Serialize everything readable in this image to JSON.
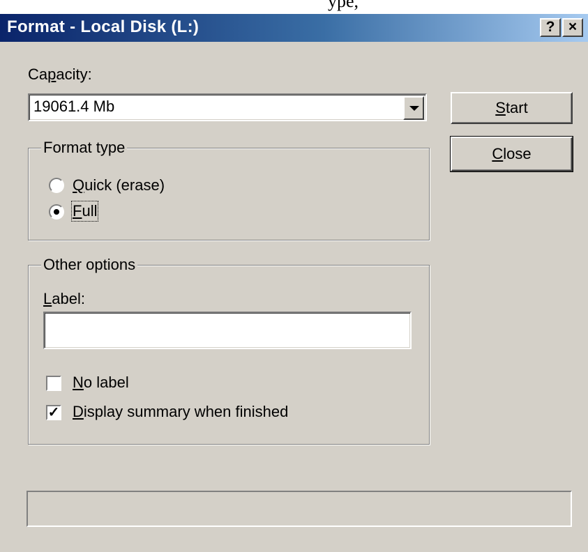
{
  "page": {
    "top_text": "ype, "
  },
  "window": {
    "title": "Format - Local Disk (L:)",
    "help_label": "?",
    "close_label": "×"
  },
  "capacity": {
    "label_pre": "Ca",
    "label_u": "p",
    "label_post": "acity:",
    "value": "19061.4 Mb"
  },
  "buttons": {
    "start": {
      "u": "S",
      "rest": "tart"
    },
    "close": {
      "u": "C",
      "rest": "lose"
    }
  },
  "format_type": {
    "legend": "Format type",
    "quick": {
      "u": "Q",
      "rest": "uick (erase)",
      "selected": false
    },
    "full": {
      "u": "F",
      "rest": "ull",
      "selected": true
    }
  },
  "other_options": {
    "legend": "Other options",
    "label_field": {
      "u": "L",
      "rest": "abel:",
      "value": ""
    },
    "no_label": {
      "u": "N",
      "rest": "o label",
      "checked": false,
      "mark": ""
    },
    "display_summary": {
      "u": "D",
      "rest": "isplay summary when finished",
      "checked": true,
      "mark": "✓"
    }
  },
  "status_bar": {
    "text": ""
  }
}
